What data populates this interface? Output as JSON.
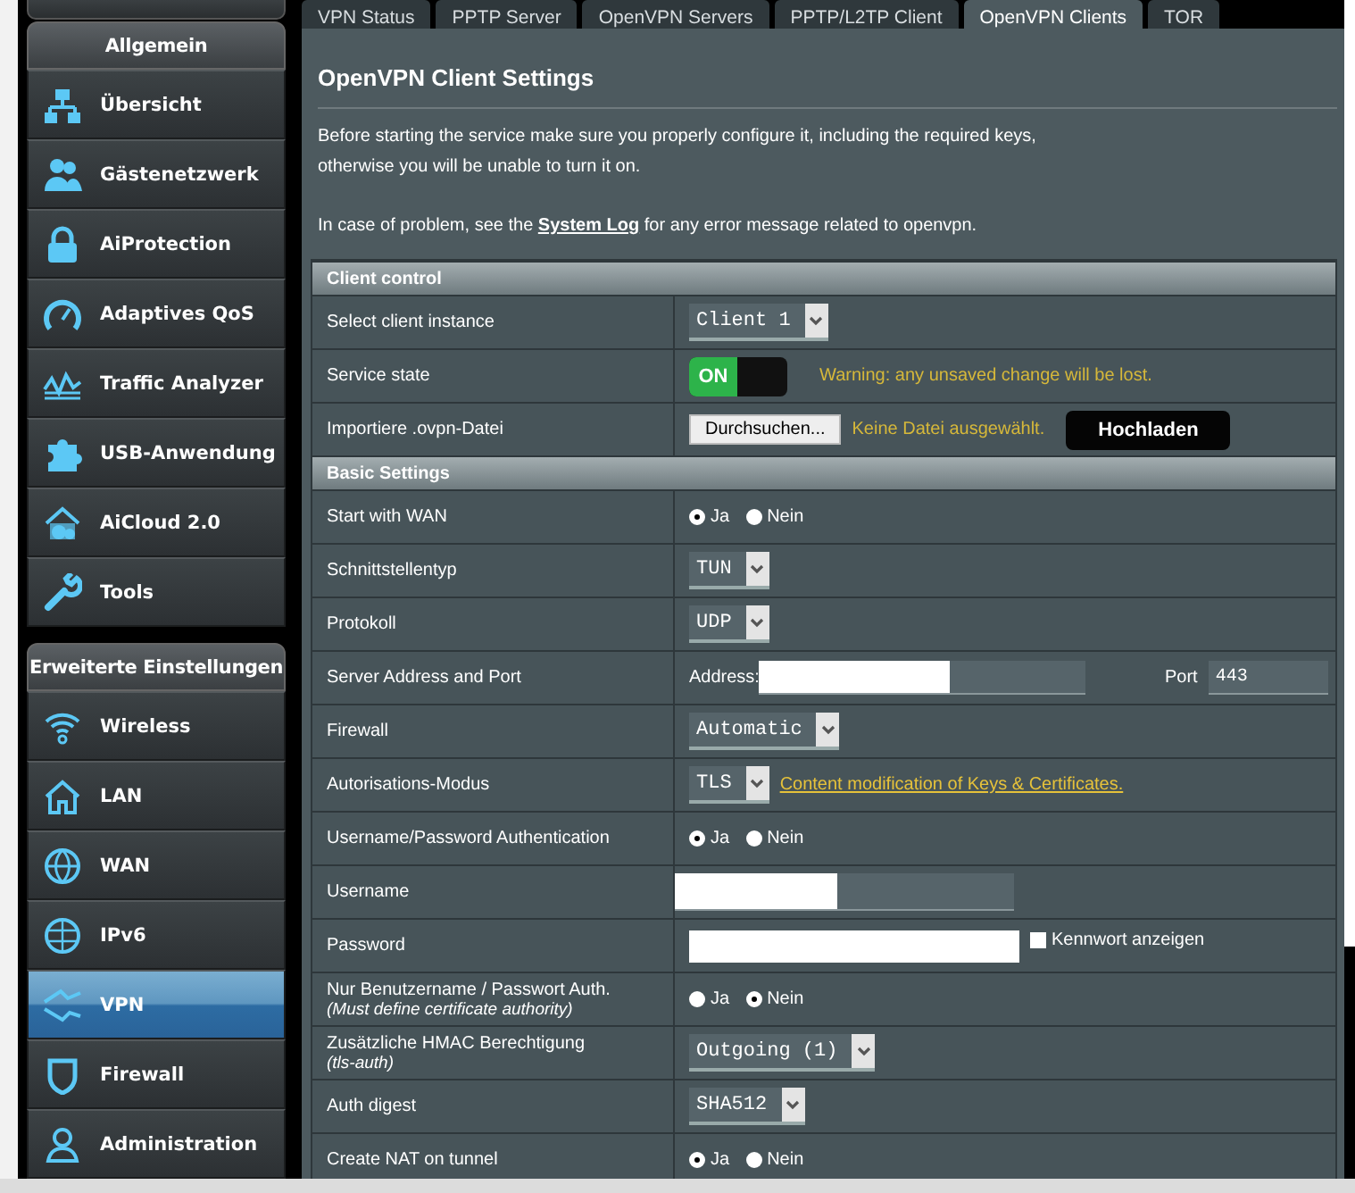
{
  "sidebar": {
    "sections": [
      {
        "title": "Allgemein",
        "items": [
          {
            "label": "Übersicht",
            "selected": false
          },
          {
            "label": "Gästenetzwerk",
            "selected": false
          },
          {
            "label": "AiProtection",
            "selected": false
          },
          {
            "label": "Adaptives QoS",
            "selected": false
          },
          {
            "label": "Traffic Analyzer",
            "selected": false
          },
          {
            "label": "USB-Anwendung",
            "selected": false
          },
          {
            "label": "AiCloud 2.0",
            "selected": false
          },
          {
            "label": "Tools",
            "selected": false
          }
        ]
      },
      {
        "title": "Erweiterte Einstellungen",
        "items": [
          {
            "label": "Wireless",
            "selected": false
          },
          {
            "label": "LAN",
            "selected": false
          },
          {
            "label": "WAN",
            "selected": false
          },
          {
            "label": "IPv6",
            "selected": false
          },
          {
            "label": "VPN",
            "selected": true
          },
          {
            "label": "Firewall",
            "selected": false
          },
          {
            "label": "Administration",
            "selected": false
          }
        ]
      }
    ]
  },
  "tabs": [
    {
      "label": "VPN Status",
      "selected": false
    },
    {
      "label": "PPTP Server",
      "selected": false
    },
    {
      "label": "OpenVPN Servers",
      "selected": false
    },
    {
      "label": "PPTP/L2TP Client",
      "selected": false
    },
    {
      "label": "OpenVPN Clients",
      "selected": true
    },
    {
      "label": "TOR",
      "selected": false
    }
  ],
  "heading": "OpenVPN Client Settings",
  "intro": [
    "Before starting the service make sure you properly configure it, including the required keys,",
    "otherwise you will be unable to turn it on."
  ],
  "notice": {
    "before": "In case of problem, see the ",
    "link": "System Log",
    "after": " for any error message related to openvpn."
  },
  "sections": [
    {
      "title": "Client control",
      "rows": [
        {
          "label": "Select client instance",
          "control": {
            "kind": "select",
            "value": "Client 1"
          }
        },
        {
          "label": "Service state",
          "control": {
            "kind": "toggle",
            "on": true,
            "label": "ON",
            "note": "Warning: any unsaved change will be lost."
          }
        },
        {
          "label": "Importiere .ovpn-Datei",
          "control": {
            "kind": "file",
            "button": "Durchsuchen...",
            "status": "Keine Datei ausgewählt.",
            "upload": "Hochladen"
          }
        }
      ]
    },
    {
      "title": "Basic Settings",
      "rows": [
        {
          "label": "Start with WAN",
          "control": {
            "kind": "radio",
            "options": [
              {
                "label": "Ja",
                "selected": true
              },
              {
                "label": "Nein",
                "selected": false
              }
            ]
          }
        },
        {
          "label": "Schnittstellentyp",
          "control": {
            "kind": "select",
            "value": "TUN"
          }
        },
        {
          "label": "Protokoll",
          "control": {
            "kind": "select",
            "value": "UDP"
          }
        },
        {
          "label": "Server Address and Port",
          "control": {
            "kind": "address",
            "label": "Address:",
            "port_label": "Port",
            "port": "443"
          }
        },
        {
          "label": "Firewall",
          "control": {
            "kind": "select",
            "value": "Automatic"
          }
        },
        {
          "label": "Autorisations-Modus",
          "control": {
            "kind": "select",
            "value": "TLS",
            "link": "Content modification of Keys & Certificates."
          }
        },
        {
          "label": "Username/Password Authentication",
          "control": {
            "kind": "radio",
            "options": [
              {
                "label": "Ja",
                "selected": true
              },
              {
                "label": "Nein",
                "selected": false
              }
            ]
          }
        },
        {
          "label": "Username",
          "control": {
            "kind": "username"
          }
        },
        {
          "label": "Password",
          "control": {
            "kind": "password",
            "checkbox": {
              "label": "Kennwort anzeigen",
              "checked": false
            }
          }
        },
        {
          "label": "Nur Benutzername / Passwort Auth.",
          "sublabel": "(Must define certificate authority)",
          "control": {
            "kind": "radio",
            "options": [
              {
                "label": "Ja",
                "selected": false
              },
              {
                "label": "Nein",
                "selected": true
              }
            ]
          }
        },
        {
          "label": "Zusätzliche HMAC Berechtigung",
          "sublabel": "(tls-auth)",
          "control": {
            "kind": "select",
            "value": "Outgoing (1)"
          }
        },
        {
          "label": "Auth digest",
          "control": {
            "kind": "select",
            "value": "SHA512"
          }
        },
        {
          "label": "Create NAT on tunnel",
          "control": {
            "kind": "radio",
            "options": [
              {
                "label": "Ja",
                "selected": true
              },
              {
                "label": "Nein",
                "selected": false
              }
            ]
          }
        }
      ]
    }
  ]
}
